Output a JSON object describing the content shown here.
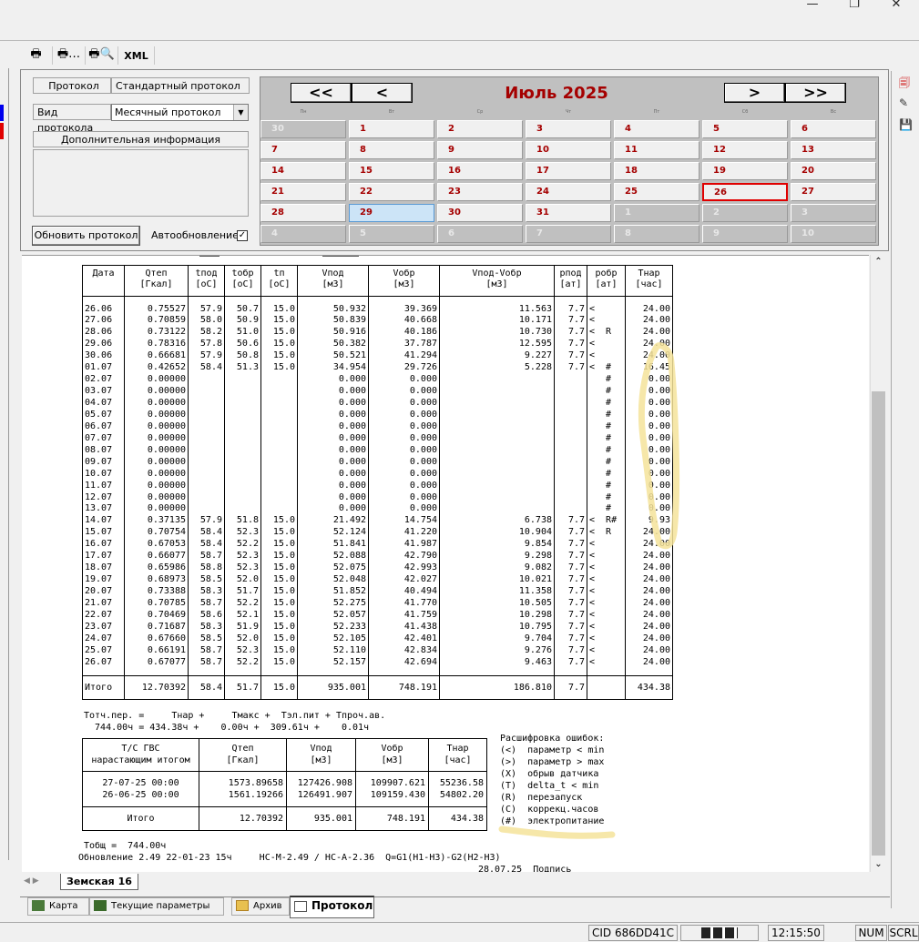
{
  "window": {
    "controls": [
      "—",
      "❐",
      "✕"
    ]
  },
  "toolbar": {
    "xml_label": "XML"
  },
  "form": {
    "protocol_label": "Протокол",
    "protocol_value": "Стандартный протокол",
    "view_label": "Вид протокола",
    "view_value": "Месячный протокол",
    "extra_label": "Дополнительная информация",
    "refresh_button": "Обновить протокол",
    "autorefresh_label": "Автообновление",
    "autorefresh_checked": true
  },
  "calendar": {
    "prev_year": "<<",
    "prev_month": "<",
    "next_month": ">",
    "next_year": ">>",
    "month_title": "Июль 2025",
    "weekdays": [
      "Пн",
      "Вт",
      "Ср",
      "Чт",
      "Пт",
      "Сб",
      "Вс"
    ],
    "days": [
      "30",
      "1",
      "2",
      "3",
      "4",
      "5",
      "6",
      "7",
      "8",
      "9",
      "10",
      "11",
      "12",
      "13",
      "14",
      "15",
      "16",
      "17",
      "18",
      "19",
      "20",
      "21",
      "22",
      "23",
      "24",
      "25",
      "26",
      "27",
      "28",
      "29",
      "30",
      "31",
      "1",
      "2",
      "3",
      "4",
      "5",
      "6",
      "7",
      "8",
      "9",
      "10"
    ],
    "selected_day": "29",
    "today": "26"
  },
  "report": {
    "headers": [
      [
        "Дата",
        ""
      ],
      [
        "Qтеп",
        "[Гкал]"
      ],
      [
        "tпод",
        "[oC]"
      ],
      [
        "tобр",
        "[oC]"
      ],
      [
        "tп",
        "[oC]"
      ],
      [
        "Vпод",
        "[м3]"
      ],
      [
        "Vобр",
        "[м3]"
      ],
      [
        "Vпод-Vобр",
        "[м3]"
      ],
      [
        "pпод",
        "[ат]"
      ],
      [
        "pобр",
        "[ат]"
      ],
      [
        "Тнар",
        "[час]"
      ]
    ],
    "rows": [
      [
        "26.06",
        "0.75527",
        "57.9",
        "50.7",
        "15.0",
        "50.932",
        "39.369",
        "11.563",
        "7.7",
        "<",
        "24.00"
      ],
      [
        "27.06",
        "0.70859",
        "58.0",
        "50.9",
        "15.0",
        "50.839",
        "40.668",
        "10.171",
        "7.7",
        "<",
        "24.00"
      ],
      [
        "28.06",
        "0.73122",
        "58.2",
        "51.0",
        "15.0",
        "50.916",
        "40.186",
        "10.730",
        "7.7",
        "<  R",
        "24.00"
      ],
      [
        "29.06",
        "0.78316",
        "57.8",
        "50.6",
        "15.0",
        "50.382",
        "37.787",
        "12.595",
        "7.7",
        "<",
        "24.00"
      ],
      [
        "30.06",
        "0.66681",
        "57.9",
        "50.8",
        "15.0",
        "50.521",
        "41.294",
        "9.227",
        "7.7",
        "<",
        "24.00"
      ],
      [
        "01.07",
        "0.42652",
        "58.4",
        "51.3",
        "15.0",
        "34.954",
        "29.726",
        "5.228",
        "7.7",
        "<  #",
        "16.45"
      ],
      [
        "02.07",
        "0.00000",
        "",
        "",
        "",
        "0.000",
        "0.000",
        "",
        "",
        "   #",
        "0.00"
      ],
      [
        "03.07",
        "0.00000",
        "",
        "",
        "",
        "0.000",
        "0.000",
        "",
        "",
        "   #",
        "0.00"
      ],
      [
        "04.07",
        "0.00000",
        "",
        "",
        "",
        "0.000",
        "0.000",
        "",
        "",
        "   #",
        "0.00"
      ],
      [
        "05.07",
        "0.00000",
        "",
        "",
        "",
        "0.000",
        "0.000",
        "",
        "",
        "   #",
        "0.00"
      ],
      [
        "06.07",
        "0.00000",
        "",
        "",
        "",
        "0.000",
        "0.000",
        "",
        "",
        "   #",
        "0.00"
      ],
      [
        "07.07",
        "0.00000",
        "",
        "",
        "",
        "0.000",
        "0.000",
        "",
        "",
        "   #",
        "0.00"
      ],
      [
        "08.07",
        "0.00000",
        "",
        "",
        "",
        "0.000",
        "0.000",
        "",
        "",
        "   #",
        "0.00"
      ],
      [
        "09.07",
        "0.00000",
        "",
        "",
        "",
        "0.000",
        "0.000",
        "",
        "",
        "   #",
        "0.00"
      ],
      [
        "10.07",
        "0.00000",
        "",
        "",
        "",
        "0.000",
        "0.000",
        "",
        "",
        "   #",
        "0.00"
      ],
      [
        "11.07",
        "0.00000",
        "",
        "",
        "",
        "0.000",
        "0.000",
        "",
        "",
        "   #",
        "0.00"
      ],
      [
        "12.07",
        "0.00000",
        "",
        "",
        "",
        "0.000",
        "0.000",
        "",
        "",
        "   #",
        "0.00"
      ],
      [
        "13.07",
        "0.00000",
        "",
        "",
        "",
        "0.000",
        "0.000",
        "",
        "",
        "   #",
        "0.00"
      ],
      [
        "14.07",
        "0.37135",
        "57.9",
        "51.8",
        "15.0",
        "21.492",
        "14.754",
        "6.738",
        "7.7",
        "<  R#",
        "9.93"
      ],
      [
        "15.07",
        "0.70754",
        "58.4",
        "52.3",
        "15.0",
        "52.124",
        "41.220",
        "10.904",
        "7.7",
        "<  R",
        "24.00"
      ],
      [
        "16.07",
        "0.67053",
        "58.4",
        "52.2",
        "15.0",
        "51.841",
        "41.987",
        "9.854",
        "7.7",
        "<",
        "24.00"
      ],
      [
        "17.07",
        "0.66077",
        "58.7",
        "52.3",
        "15.0",
        "52.088",
        "42.790",
        "9.298",
        "7.7",
        "<",
        "24.00"
      ],
      [
        "18.07",
        "0.65986",
        "58.8",
        "52.3",
        "15.0",
        "52.075",
        "42.993",
        "9.082",
        "7.7",
        "<",
        "24.00"
      ],
      [
        "19.07",
        "0.68973",
        "58.5",
        "52.0",
        "15.0",
        "52.048",
        "42.027",
        "10.021",
        "7.7",
        "<",
        "24.00"
      ],
      [
        "20.07",
        "0.73388",
        "58.3",
        "51.7",
        "15.0",
        "51.852",
        "40.494",
        "11.358",
        "7.7",
        "<",
        "24.00"
      ],
      [
        "21.07",
        "0.70785",
        "58.7",
        "52.2",
        "15.0",
        "52.275",
        "41.770",
        "10.505",
        "7.7",
        "<",
        "24.00"
      ],
      [
        "22.07",
        "0.70469",
        "58.6",
        "52.1",
        "15.0",
        "52.057",
        "41.759",
        "10.298",
        "7.7",
        "<",
        "24.00"
      ],
      [
        "23.07",
        "0.71687",
        "58.3",
        "51.9",
        "15.0",
        "52.233",
        "41.438",
        "10.795",
        "7.7",
        "<",
        "24.00"
      ],
      [
        "24.07",
        "0.67660",
        "58.5",
        "52.0",
        "15.0",
        "52.105",
        "42.401",
        "9.704",
        "7.7",
        "<",
        "24.00"
      ],
      [
        "25.07",
        "0.66191",
        "58.7",
        "52.3",
        "15.0",
        "52.110",
        "42.834",
        "9.276",
        "7.7",
        "<",
        "24.00"
      ],
      [
        "26.07",
        "0.67077",
        "58.7",
        "52.2",
        "15.0",
        "52.157",
        "42.694",
        "9.463",
        "7.7",
        "<",
        "24.00"
      ]
    ],
    "total": [
      "Итого",
      "12.70392",
      "58.4",
      "51.7",
      "15.0",
      "935.001",
      "748.191",
      "186.810",
      "7.7",
      "",
      "434.38"
    ],
    "balance_line1": "Тотч.пер. =     Тнар +     Тмакс +  Тэл.пит + Тпроч.ав.",
    "balance_line2": "  744.00ч = 434.38ч +    0.00ч +  309.61ч +    0.01ч",
    "cumulative": {
      "headers": [
        [
          "Т/С ГВС",
          "нарастающим итогом"
        ],
        [
          "Qтеп",
          "[Гкал]"
        ],
        [
          "Vпод",
          "[м3]"
        ],
        [
          "Vобр",
          "[м3]"
        ],
        [
          "Тнар",
          "[час]"
        ]
      ],
      "rows": [
        [
          "27-07-25 00:00",
          "1573.89658",
          "127426.908",
          "109907.621",
          "55236.58"
        ],
        [
          "26-06-25 00:00",
          "1561.19266",
          "126491.907",
          "109159.430",
          "54802.20"
        ]
      ],
      "total": [
        "Итого",
        "12.70392",
        "935.001",
        "748.191",
        "434.38"
      ]
    },
    "legend_title": "Расшифровка ошибок:",
    "legend": [
      "(<)  параметр < min",
      "(>)  параметр > max",
      "(X)  обрыв датчика",
      "(T)  delta_t < min",
      "(R)  перезапуск",
      "(C)  коррекц.часов",
      "(#)  электропитание"
    ],
    "t_total": "Тобщ =  744.00ч",
    "update_line": "Обновление 2.49 22-01-23 15ч     НС-М-2.49 / НС-А-2.36  Q=G1(H1-H3)-G2(H2-H3)",
    "sign_line": "28.07.25  Подпись ________________"
  },
  "sheet_tab": "Земская 16",
  "bottom_tabs": [
    "Карта",
    "Текущие параметры",
    "Архив",
    "Протокол"
  ],
  "status": {
    "cid": "CID 686DD41C",
    "time": "12:15:50",
    "num": "NUM",
    "scrl": "SCRL"
  },
  "colors": {
    "accent": "#a50000",
    "highlight": "#f5e39a",
    "today_border": "#e00000"
  }
}
